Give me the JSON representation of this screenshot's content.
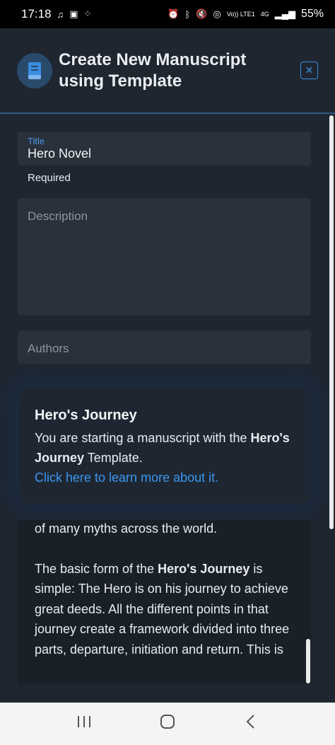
{
  "status_bar": {
    "time": "17:18",
    "left_icons": [
      "music-note-icon",
      "image-icon",
      "dots-icon"
    ],
    "right_icons": [
      "alarm-icon",
      "bluetooth-icon",
      "mute-icon",
      "hotspot-icon"
    ],
    "volte_label": "Vo)) LTE1",
    "network_label": "4G",
    "battery": "55%"
  },
  "header": {
    "title": "Create New Manuscript using Template",
    "icon": "book-icon",
    "close_icon": "close-icon"
  },
  "form": {
    "title_label": "Title",
    "title_value": "Hero Novel",
    "title_helper": "Required",
    "description_placeholder": "Description",
    "authors_placeholder": "Authors"
  },
  "template_card": {
    "title": "Hero's Journey",
    "text_before": "You are starting a manuscript with the ",
    "template_name": "Hero's Journey",
    "text_after": " Template.",
    "link": "Click here to learn more about it."
  },
  "description_text": {
    "line_top": "of many myths across the world.",
    "para_prefix": "The basic form of the ",
    "para_bold": "Hero's Journey",
    "para_rest": " is simple: The Hero is on his journey to achieve great deeds. All the different points in that journey create a framework divided into three parts, departure, initiation and return. This is"
  },
  "nav_bar": {
    "recents_icon": "recents-icon",
    "home_icon": "home-icon",
    "back_icon": "back-icon"
  },
  "colors": {
    "accent": "#3b8ee0",
    "background": "#1f2630",
    "field": "#2a313b"
  }
}
